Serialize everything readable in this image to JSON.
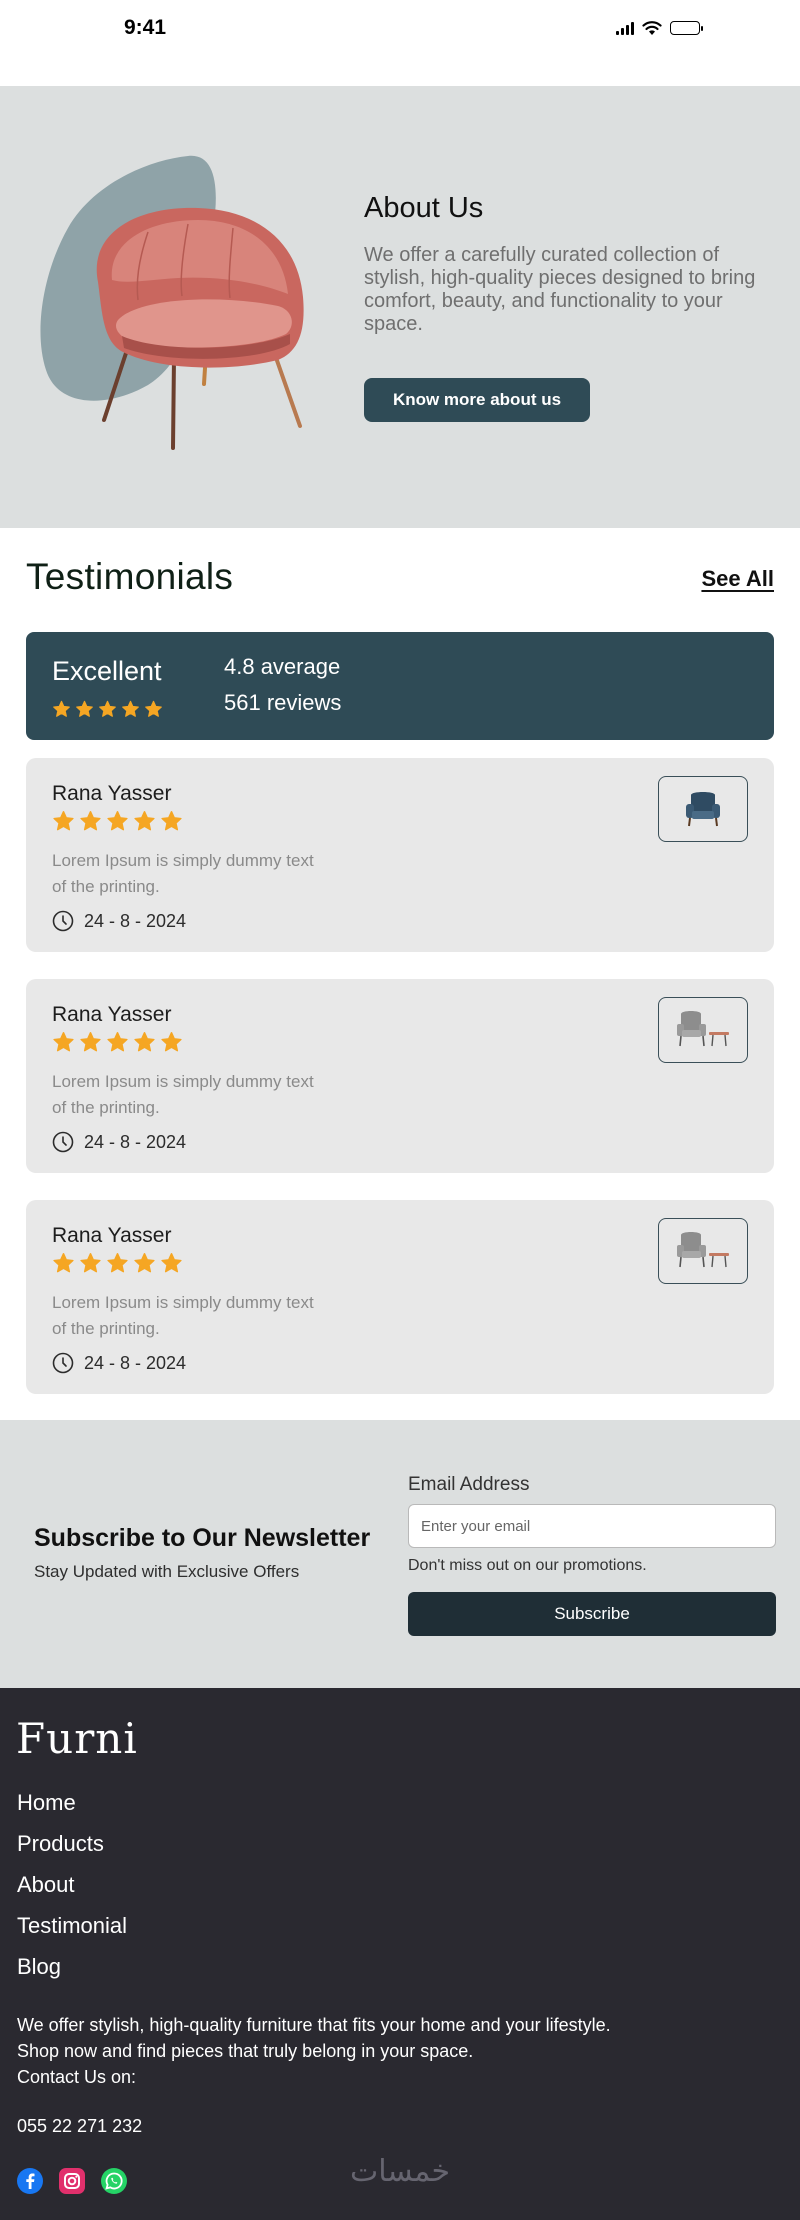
{
  "status_bar": {
    "time": "9:41"
  },
  "about": {
    "title": "About Us",
    "description": "We offer a carefully curated collection of stylish, high-quality pieces designed to bring comfort, beauty, and functionality to your space.",
    "button_label": "Know more about us",
    "colors": {
      "background": "#dcdfdf",
      "blob": "#8fa3a8",
      "chair": "#cf7a72",
      "button": "#2f4b56"
    }
  },
  "testimonials": {
    "title": "Testimonials",
    "see_all_label": "See All",
    "summary": {
      "label": "Excellent",
      "stars": 5,
      "average_text": "4.8 average",
      "reviews_text": "561 reviews"
    },
    "reviews": [
      {
        "name": "Rana Yasser",
        "stars": 5,
        "text": "Lorem Ipsum is simply dummy text of the printing.",
        "date": "24 - 8 - 2024",
        "thumb_icon": "blue-armchair-icon"
      },
      {
        "name": "Rana Yasser",
        "stars": 5,
        "text": "Lorem Ipsum is simply dummy text of the printing.",
        "date": "24 - 8 - 2024",
        "thumb_icon": "grey-armchair-with-table-icon"
      },
      {
        "name": "Rana Yasser",
        "stars": 5,
        "text": "Lorem Ipsum is simply dummy text of the printing.",
        "date": "24 - 8 - 2024",
        "thumb_icon": "grey-armchair-with-table-icon"
      }
    ],
    "colors": {
      "star": "#f5a623",
      "summary_bg": "#2f4b56",
      "card_bg": "#e8e8e8"
    }
  },
  "newsletter": {
    "title": "Subscribe to Our Newsletter",
    "subtitle": "Stay Updated with Exclusive Offers",
    "email_label": "Email Address",
    "email_placeholder": "Enter your email",
    "email_value": "",
    "hint": "Don't miss out on our promotions.",
    "button_label": "Subscribe"
  },
  "footer": {
    "logo": "Furni",
    "nav": [
      {
        "label": "Home"
      },
      {
        "label": "Products"
      },
      {
        "label": "About"
      },
      {
        "label": "Testimonial"
      },
      {
        "label": "Blog"
      }
    ],
    "about_text": "We offer stylish, high-quality furniture that fits your home and your lifestyle.\n Shop now and find pieces that truly belong in your space.\nContact Us on:",
    "phone": "055 22 271 232",
    "social": [
      {
        "icon": "facebook-icon",
        "color": "#1877f2"
      },
      {
        "icon": "instagram-icon",
        "color": "#e1306c"
      },
      {
        "icon": "whatsapp-icon",
        "color": "#25d366"
      }
    ],
    "watermark": "خمسات",
    "colors": {
      "background": "#2a2930"
    }
  }
}
